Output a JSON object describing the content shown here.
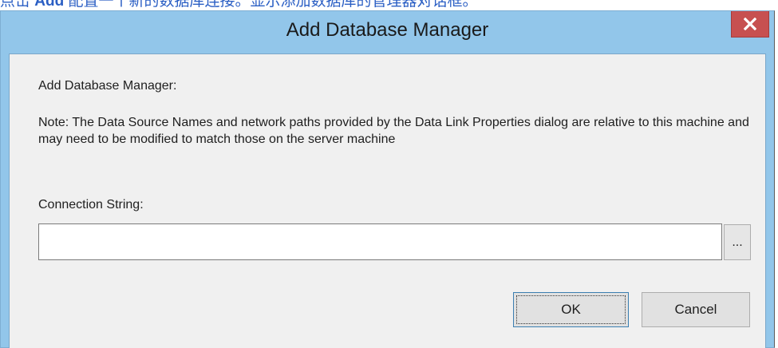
{
  "background": {
    "caption_prefix": "点击 ",
    "caption_bold": "Add",
    "caption_suffix": " 配置一个新的数据库连接。显示添加数据库的管理器对话框。"
  },
  "dialog": {
    "title": "Add Database Manager",
    "close_label": "x",
    "heading": "Add Database Manager:",
    "note": "Note: The Data Source Names and network paths provided by the Data Link Properties dialog are relative to this machine and may need to be modified to match those on the server machine",
    "connection_label": "Connection String:",
    "connection_value": "",
    "browse_label": "...",
    "ok_label": "OK",
    "cancel_label": "Cancel"
  },
  "colors": {
    "title_bar": "#92c6ea",
    "close_button": "#c75050",
    "client_background": "#f0f0f0",
    "caption_text": "#2b5fc4"
  },
  "icons": {
    "close": "close-icon"
  }
}
